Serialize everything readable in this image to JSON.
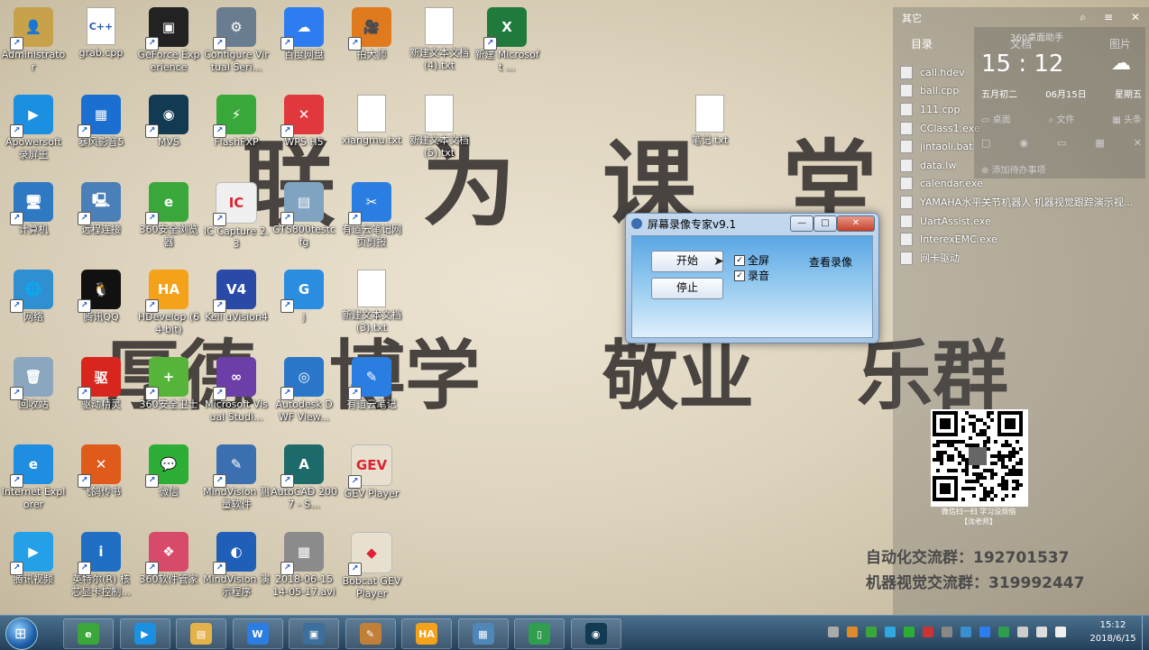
{
  "wallpaper": {
    "line1": [
      "联",
      "为",
      "课",
      "堂"
    ],
    "line2": [
      "厚德",
      "博学",
      "敬业",
      "乐群"
    ],
    "qr_caption_1": "微信扫一扫 学习没烦恼",
    "qr_caption_2": "【沈老师】",
    "ad_1": "自动化交流群：192701537",
    "ad_2": "机器视觉交流群：319992447"
  },
  "desktop_icons": [
    {
      "label": "Administrato r",
      "color": "#c8a24a",
      "glyph": "👤",
      "col": 0,
      "row": 0
    },
    {
      "label": "grab.cpp",
      "color": "#ffffff",
      "glyph": "C++",
      "col": 1,
      "row": 0,
      "doc": true
    },
    {
      "label": "GeForce Experience",
      "color": "#222222",
      "glyph": "▣",
      "col": 2,
      "row": 0
    },
    {
      "label": "Configure Virtual Seri...",
      "color": "#6a7d90",
      "glyph": "⚙",
      "col": 3,
      "row": 0
    },
    {
      "label": "百度网盘",
      "color": "#2d7cf0",
      "glyph": "☁",
      "col": 4,
      "row": 0
    },
    {
      "label": "拍大师",
      "color": "#e07a1f",
      "glyph": "🎥",
      "col": 5,
      "row": 0
    },
    {
      "label": "新建文本文档 (4).txt",
      "color": "#ffffff",
      "glyph": "",
      "col": 6,
      "row": 0,
      "doc": true
    },
    {
      "label": "新建 Microsoft ...",
      "color": "#1f7a3c",
      "glyph": "X",
      "col": 7,
      "row": 0
    },
    {
      "label": "Apowersoft 录屏王",
      "color": "#1b8fe0",
      "glyph": "▶",
      "col": 0,
      "row": 1
    },
    {
      "label": "暴风影音5",
      "color": "#1a6fd0",
      "glyph": "▦",
      "col": 1,
      "row": 1
    },
    {
      "label": "MVS",
      "color": "#123a52",
      "glyph": "◉",
      "col": 2,
      "row": 1
    },
    {
      "label": "FlashFXP",
      "color": "#38a83a",
      "glyph": "⚡",
      "col": 3,
      "row": 1
    },
    {
      "label": "WPS H5",
      "color": "#e0383c",
      "glyph": "✕",
      "col": 4,
      "row": 1
    },
    {
      "label": "xiangmu.txt",
      "color": "#ffffff",
      "glyph": "",
      "col": 5,
      "row": 1,
      "doc": true
    },
    {
      "label": "新建文本文档 (5).txt",
      "color": "#ffffff",
      "glyph": "",
      "col": 6,
      "row": 1,
      "doc": true
    },
    {
      "label": "笔记.txt",
      "color": "#ffffff",
      "glyph": "",
      "col": 10,
      "row": 1,
      "doc": true
    },
    {
      "label": "计算机",
      "color": "#2f78c2",
      "glyph": "🖥",
      "col": 0,
      "row": 2
    },
    {
      "label": "远程连接",
      "color": "#4a7fb8",
      "glyph": "🖳",
      "col": 1,
      "row": 2
    },
    {
      "label": "360安全浏览器",
      "color": "#3aa73a",
      "glyph": "e",
      "col": 2,
      "row": 2
    },
    {
      "label": "IC Capture 2.3",
      "color": "#f0f0f0",
      "glyph": "IC",
      "col": 3,
      "row": 2
    },
    {
      "label": "GTS800testc fg",
      "color": "#7fa3c0",
      "glyph": "▤",
      "col": 4,
      "row": 2
    },
    {
      "label": "有道云笔记网页剪报",
      "color": "#2a7de1",
      "glyph": "✂",
      "col": 5,
      "row": 2
    },
    {
      "label": "网络",
      "color": "#2f8fd0",
      "glyph": "🌐",
      "col": 0,
      "row": 3
    },
    {
      "label": "腾讯QQ",
      "color": "#111111",
      "glyph": "🐧",
      "col": 1,
      "row": 3
    },
    {
      "label": "HDevelop (64-bit)",
      "color": "#f3a21a",
      "glyph": "HA",
      "col": 2,
      "row": 3
    },
    {
      "label": "Keil uVision4",
      "color": "#2a4aa8",
      "glyph": "V4",
      "col": 3,
      "row": 3
    },
    {
      "label": "j",
      "color": "#2a8de0",
      "glyph": "G",
      "col": 4,
      "row": 3
    },
    {
      "label": "新建文本文档 (3).txt",
      "color": "#ffffff",
      "glyph": "",
      "col": 5,
      "row": 3,
      "doc": true
    },
    {
      "label": "回收站",
      "color": "#8aa7bf",
      "glyph": "🗑",
      "col": 0,
      "row": 4
    },
    {
      "label": "驱动精灵",
      "color": "#d8251d",
      "glyph": "驱",
      "col": 1,
      "row": 4
    },
    {
      "label": "360安全卫士",
      "color": "#56b43a",
      "glyph": "+",
      "col": 2,
      "row": 4
    },
    {
      "label": "Microsoft Visual Studi...",
      "color": "#6c3ea8",
      "glyph": "∞",
      "col": 3,
      "row": 4
    },
    {
      "label": "Autodesk DWF View...",
      "color": "#2a76c8",
      "glyph": "◎",
      "col": 4,
      "row": 4
    },
    {
      "label": "有道云笔记",
      "color": "#2a7de1",
      "glyph": "✎",
      "col": 5,
      "row": 4
    },
    {
      "label": "Internet Explorer",
      "color": "#1f8ee0",
      "glyph": "e",
      "col": 0,
      "row": 5
    },
    {
      "label": "飞鸽传书",
      "color": "#e05a1c",
      "glyph": "✕",
      "col": 1,
      "row": 5
    },
    {
      "label": "微信",
      "color": "#2cae36",
      "glyph": "💬",
      "col": 2,
      "row": 5
    },
    {
      "label": "MindVision 测量软件",
      "color": "#3b6fb0",
      "glyph": "✎",
      "col": 3,
      "row": 5
    },
    {
      "label": "AutoCAD 2007 - S...",
      "color": "#1d6a6a",
      "glyph": "A",
      "col": 4,
      "row": 5
    },
    {
      "label": "GEV Player",
      "color": "#e8e0cf",
      "glyph": "GEV",
      "col": 5,
      "row": 5
    },
    {
      "label": "腾讯视频",
      "color": "#24a0e8",
      "glyph": "▶",
      "col": 0,
      "row": 6
    },
    {
      "label": "英特尔(R) 核芯显卡控制...",
      "color": "#1f6fc4",
      "glyph": "i",
      "col": 1,
      "row": 6
    },
    {
      "label": "360软件管家",
      "color": "#d84a6a",
      "glyph": "❖",
      "col": 2,
      "row": 6
    },
    {
      "label": "MindVision 演示程序",
      "color": "#1f5fb8",
      "glyph": "◐",
      "col": 3,
      "row": 6
    },
    {
      "label": "2018-06-15 14-05-17.avi",
      "color": "#8b8b8b",
      "glyph": "▦",
      "col": 4,
      "row": 6
    },
    {
      "label": "Bobcat GEV Player",
      "color": "#e8e0cf",
      "glyph": "◆",
      "col": 5,
      "row": 6
    }
  ],
  "right_panel": {
    "top_left": "其它",
    "tabs": [
      "目录",
      "文档",
      "图片"
    ],
    "files": [
      "call.hdev",
      "ball.cpp",
      "111.cpp",
      "CClass1.exe",
      "jintaoli.bat",
      "data.lw",
      "calendar.exe",
      "YAMAHA水平关节机器人 机器视觉跟踪演示视...",
      "UartAssist.exe",
      "InterexEMC.exe",
      "网卡驱动"
    ]
  },
  "clock_widget": {
    "header": "360桌面助手",
    "time": "15 : 12",
    "lunar": "五月初二",
    "date": "06月15日",
    "weekday": "星期五",
    "actions_row1": [
      "桌面",
      "文件",
      "头条"
    ],
    "add_todo": "添加待办事项"
  },
  "dialog": {
    "title": "屏幕录像专家v9.1",
    "start_label": "开始",
    "stop_label": "停止",
    "fullscreen_label": "全屏",
    "audio_label": "录音",
    "view_label": "查看录像",
    "fullscreen_checked": true,
    "audio_checked": true
  },
  "taskbar": {
    "apps": [
      {
        "name": "360安全浏览器",
        "glyph": "e",
        "color": "#3aa73a"
      },
      {
        "name": "Apowersoft",
        "glyph": "▶",
        "color": "#1b8fe0"
      },
      {
        "name": "资源管理器",
        "glyph": "▤",
        "color": "#e3b24a"
      },
      {
        "name": "WPS",
        "glyph": "W",
        "color": "#2a7de1"
      },
      {
        "name": "屏幕录像",
        "glyph": "▣",
        "color": "#3d6f9c"
      },
      {
        "name": "画图",
        "glyph": "✎",
        "color": "#c0803a"
      },
      {
        "name": "HDevelop",
        "glyph": "HA",
        "color": "#f3a21a"
      },
      {
        "name": "程序",
        "glyph": "▦",
        "color": "#4f87b8"
      },
      {
        "name": "InterexEMC",
        "glyph": "▯",
        "color": "#2f9e4f"
      },
      {
        "name": "MVS",
        "glyph": "◉",
        "color": "#123a52"
      }
    ],
    "time": "15:12",
    "date": "2018/6/15"
  }
}
